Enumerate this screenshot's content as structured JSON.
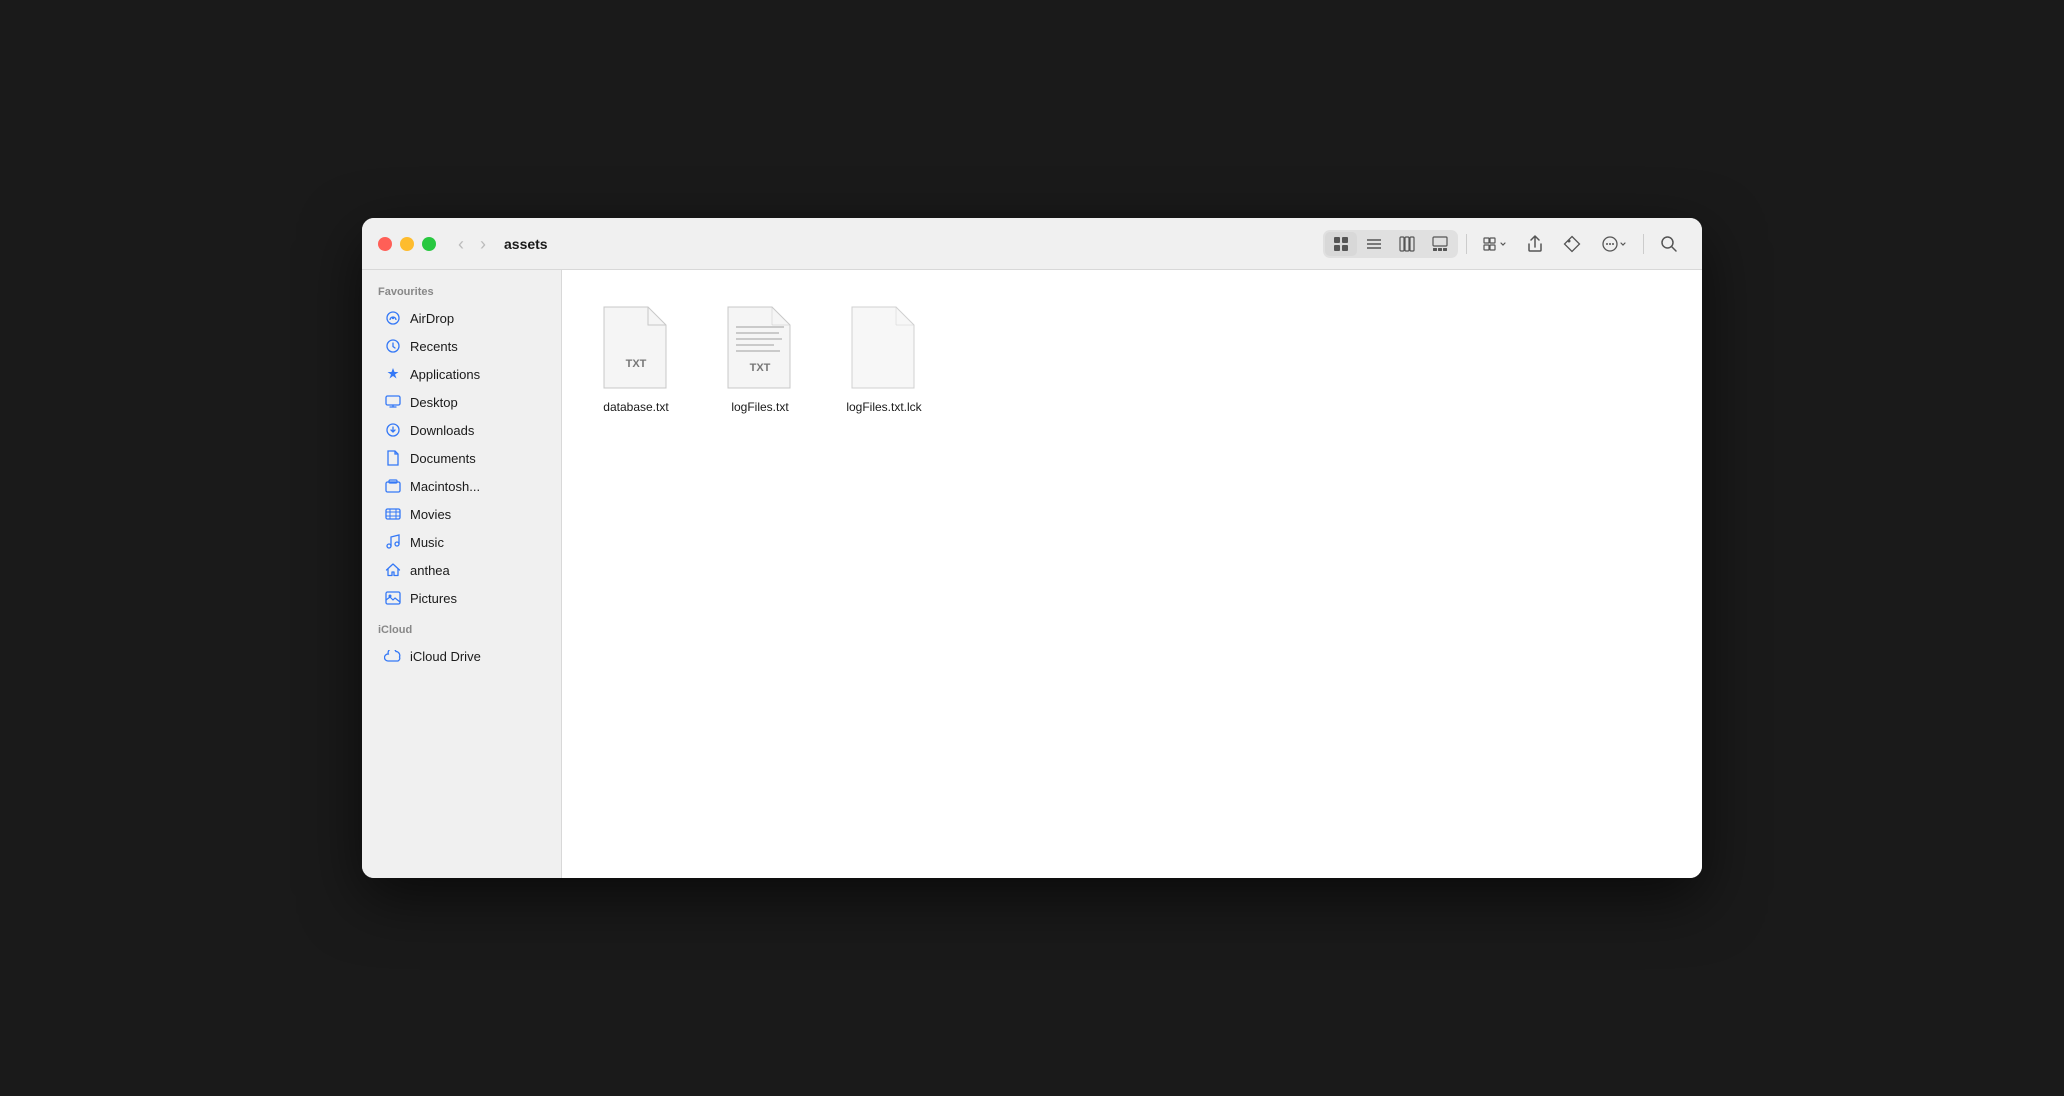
{
  "window": {
    "title": "assets"
  },
  "traffic_lights": {
    "close_color": "#ff5f57",
    "minimize_color": "#febc2e",
    "maximize_color": "#28c840"
  },
  "toolbar": {
    "back_label": "‹",
    "forward_label": "›",
    "icon_grid_label": "⊞",
    "icon_list_label": "≡",
    "icon_columns_label": "⊟",
    "icon_gallery_label": "⊡",
    "icon_sort_label": "⊞",
    "icon_share_label": "↑",
    "icon_tag_label": "⬡",
    "icon_more_label": "⊙",
    "icon_search_label": "⌕"
  },
  "sidebar": {
    "favourites_label": "Favourites",
    "icloud_label": "iCloud",
    "items": [
      {
        "id": "airdrop",
        "label": "AirDrop",
        "icon": "airdrop"
      },
      {
        "id": "recents",
        "label": "Recents",
        "icon": "recents"
      },
      {
        "id": "applications",
        "label": "Applications",
        "icon": "applications"
      },
      {
        "id": "desktop",
        "label": "Desktop",
        "icon": "desktop"
      },
      {
        "id": "downloads",
        "label": "Downloads",
        "icon": "downloads"
      },
      {
        "id": "documents",
        "label": "Documents",
        "icon": "documents"
      },
      {
        "id": "macintosh",
        "label": "Macintosh...",
        "icon": "macintosh"
      },
      {
        "id": "movies",
        "label": "Movies",
        "icon": "movies"
      },
      {
        "id": "music",
        "label": "Music",
        "icon": "music"
      },
      {
        "id": "anthea",
        "label": "anthea",
        "icon": "home"
      },
      {
        "id": "pictures",
        "label": "Pictures",
        "icon": "pictures"
      }
    ],
    "icloud_items": [
      {
        "id": "icloud-drive",
        "label": "iCloud Drive",
        "icon": "icloud"
      }
    ]
  },
  "files": [
    {
      "id": "database-txt",
      "name": "database.txt",
      "type": "txt",
      "has_lines": false
    },
    {
      "id": "logfiles-txt",
      "name": "logFiles.txt",
      "type": "txt",
      "has_lines": true
    },
    {
      "id": "logfiles-lck",
      "name": "logFiles.txt.lck",
      "type": "blank",
      "has_lines": false
    }
  ]
}
